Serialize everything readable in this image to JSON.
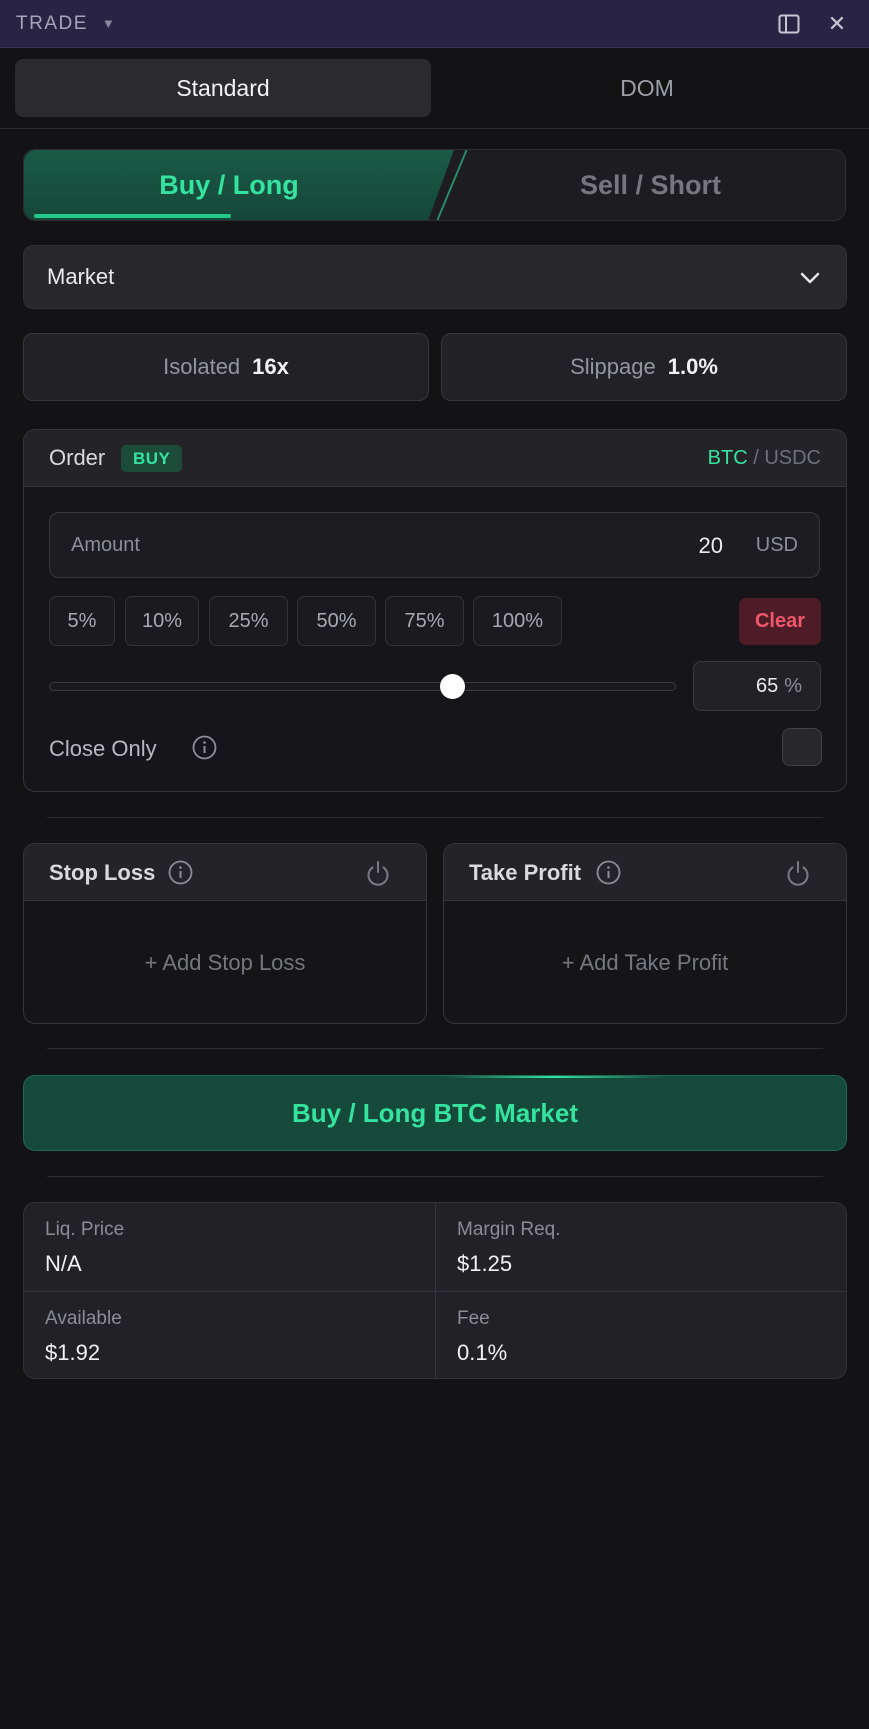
{
  "window": {
    "title": "TRADE",
    "menu_caret": "▼",
    "close_glyph": "✕"
  },
  "mode_tabs": [
    {
      "label": "Standard",
      "active": true
    },
    {
      "label": "DOM",
      "active": false
    }
  ],
  "side": {
    "buy_label": "Buy / Long",
    "sell_label": "Sell / Short",
    "selected": "buy"
  },
  "order_type": {
    "value": "Market"
  },
  "margin_mode": {
    "label": "Isolated",
    "value": "16x"
  },
  "slippage": {
    "label": "Slippage",
    "value": "1.0%"
  },
  "order": {
    "title": "Order",
    "badge": "BUY",
    "pair_base": "BTC",
    "pair_sep": " / ",
    "pair_quote": "USDC",
    "amount_label": "Amount",
    "amount_value": "20",
    "amount_unit": "USD",
    "percent_buttons": [
      "5%",
      "10%",
      "25%",
      "50%",
      "75%",
      "100%"
    ],
    "clear_label": "Clear",
    "slider_value": "65",
    "slider_unit": "%",
    "slider_fraction": 0.65,
    "close_only_label": "Close Only",
    "close_only_checked": false
  },
  "stop_loss": {
    "title": "Stop Loss",
    "add_label": "+ Add Stop Loss"
  },
  "take_profit": {
    "title": "Take Profit",
    "add_label": "+ Add Take Profit"
  },
  "submit": {
    "label": "Buy / Long BTC Market"
  },
  "stats": {
    "liq_price": {
      "label": "Liq. Price",
      "value": "N/A"
    },
    "margin_req": {
      "label": "Margin Req.",
      "value": "$1.25"
    },
    "available": {
      "label": "Available",
      "value": "$1.92"
    },
    "fee": {
      "label": "Fee",
      "value": "0.1%"
    }
  },
  "colors": {
    "accent_green": "#35e39f",
    "danger_red": "#f0566c",
    "titlebar": "#2a2444",
    "background": "#131215"
  },
  "icons": [
    "chevron-down-icon",
    "info-icon",
    "power-icon",
    "panel-icon",
    "close-icon",
    "caret-down-icon"
  ]
}
